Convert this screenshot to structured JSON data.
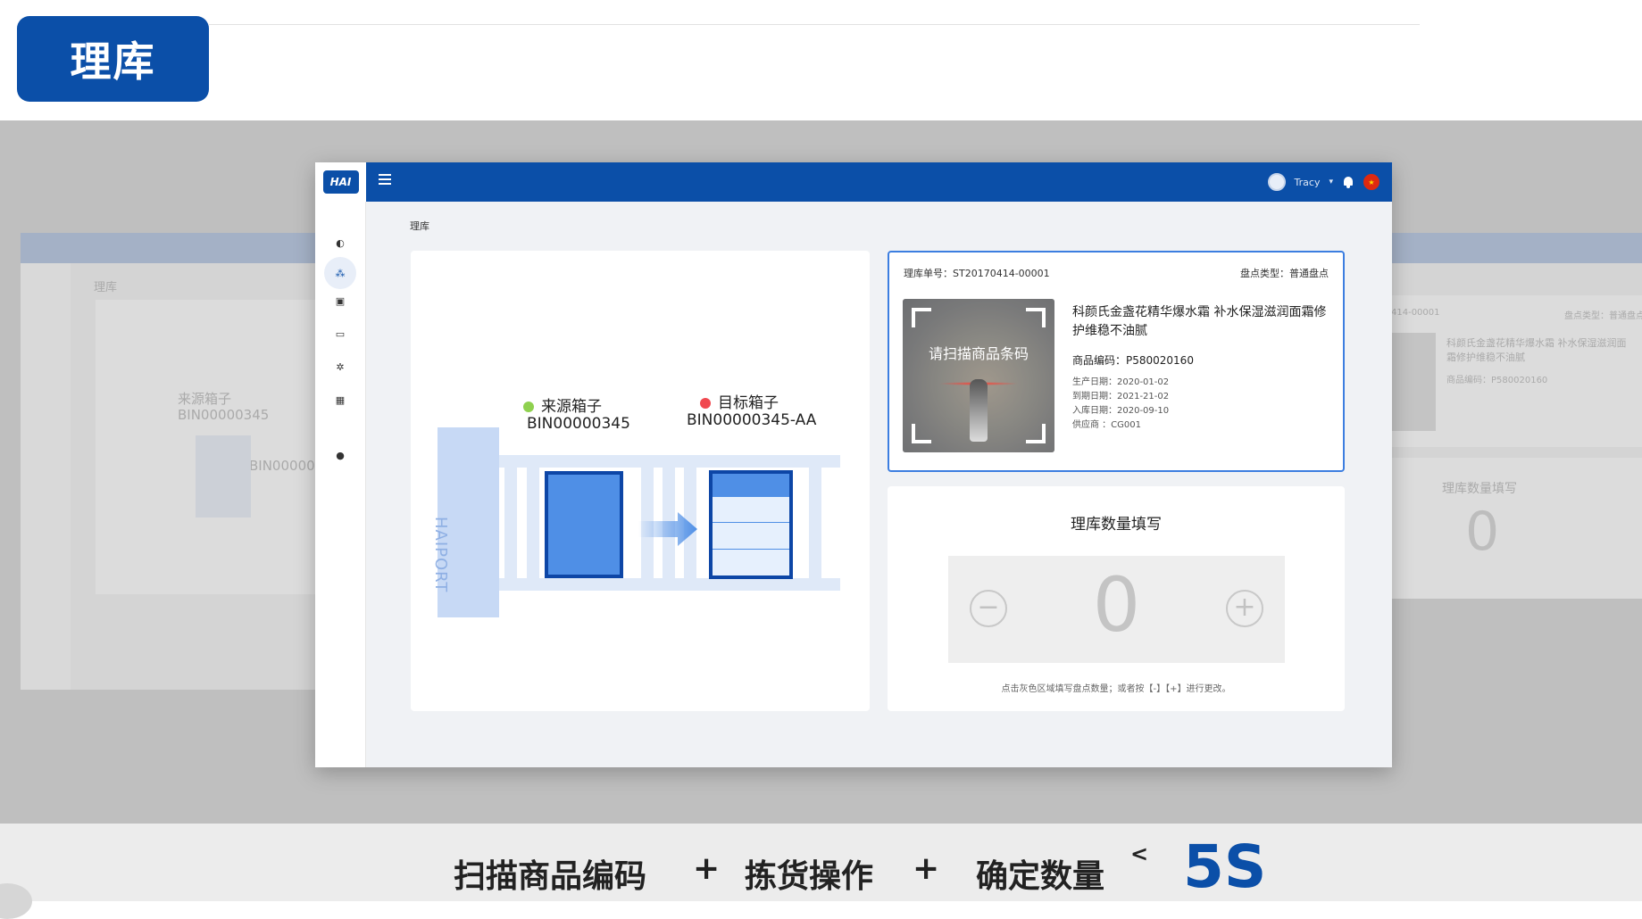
{
  "slide": {
    "title": "理库"
  },
  "app": {
    "logo_text": "HAI",
    "user_name": "Tracy",
    "breadcrumb": "理库",
    "left_panel": {
      "source_label": "来源箱子",
      "source_code": "BIN00000345",
      "target_label": "目标箱子",
      "target_code": "BIN00000345-AA",
      "port_label": "HAIPORT"
    },
    "info_card": {
      "order_no": "理库单号：ST20170414-00001",
      "count_type": "盘点类型：普通盘点",
      "scan_prompt": "请扫描商品条码",
      "product_name": "科颜氏金盏花精华爆水霜 补水保湿滋润面霜修护维稳不油腻",
      "product_code": "商品编码：P580020160",
      "meta": [
        "生产日期：2020-01-02",
        "到期日期：2021-21-02",
        "入库日期：2020-09-10",
        "供应商 ：CG001"
      ]
    },
    "qty_card": {
      "title": "理库数量填写",
      "value": "0",
      "minus": "−",
      "plus": "+",
      "hint": "点击灰色区域填写盘点数量；或者按【-】【+】进行更改。"
    }
  },
  "ghost_right": {
    "order_fragment": "414-00001",
    "count_type": "盘点类型：普通盘点",
    "product_name": "科颜氏金盏花精华爆水霜 补水保湿滋润面霜修护维稳不油腻",
    "product_code": "商品编码：P580020160",
    "qty_title": "理库数量填写",
    "value": "0"
  },
  "ghost_left": {
    "breadcrumb": "理库",
    "source_label": "来源箱子",
    "source_code": "BIN00000345",
    "target_fragment": "BIN000003"
  },
  "caption": {
    "step1": "扫描商品编码",
    "plus": "+",
    "step2": "拣货操作",
    "step3": "确定数量",
    "lt": "<",
    "time": "5S"
  },
  "colors": {
    "brand": "#0b4fa8",
    "box_fill": "#4f8fe6",
    "source_dot": "#8fd14f",
    "target_dot": "#f0484f"
  }
}
